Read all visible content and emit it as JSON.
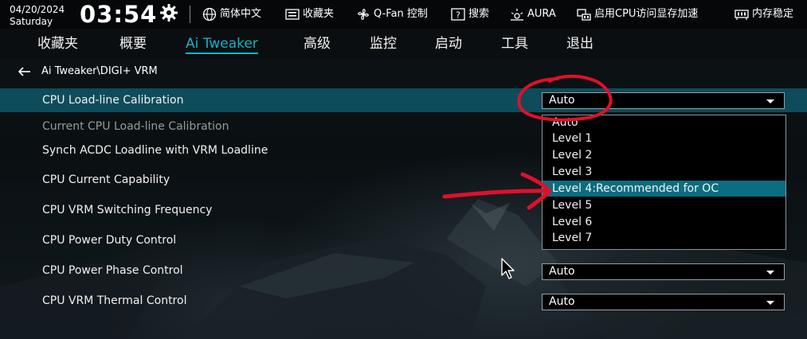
{
  "status": {
    "date": "04/20/2024",
    "day": "Saturday",
    "time": "03:54"
  },
  "toolbar": [
    {
      "label": "简体中文",
      "icon": "globe-icon"
    },
    {
      "label": "收藏夹",
      "icon": "keyboard-icon"
    },
    {
      "label": "Q-Fan 控制",
      "icon": "fan-icon"
    },
    {
      "label": "搜索",
      "icon": "help-icon"
    },
    {
      "label": "AURA",
      "icon": "aura-icon"
    },
    {
      "label": "启用CPU访问显存加速",
      "icon": "memory-access-icon"
    },
    {
      "label": "内存稳定",
      "icon": "memory-icon"
    }
  ],
  "nav": {
    "tabs": [
      {
        "label": "收藏夹"
      },
      {
        "label": "概要"
      },
      {
        "label": "Ai Tweaker",
        "active": true
      },
      {
        "label": "高级"
      },
      {
        "label": "监控"
      },
      {
        "label": "启动"
      },
      {
        "label": "工具"
      },
      {
        "label": "退出"
      }
    ]
  },
  "breadcrumb": "Ai Tweaker\\DIGI+ VRM",
  "settings": [
    {
      "label": "CPU Load-line Calibration",
      "value": "Auto",
      "selected": true
    },
    {
      "label": "Current CPU Load-line Calibration",
      "dim": true
    },
    {
      "label": "Synch ACDC Loadline with VRM Loadline"
    },
    {
      "label": "CPU Current Capability"
    },
    {
      "label": "CPU VRM Switching Frequency"
    },
    {
      "label": "CPU Power Duty Control"
    },
    {
      "label": "CPU Power Phase Control",
      "value": "Auto"
    },
    {
      "label": "CPU VRM Thermal Control",
      "value": "Auto"
    }
  ],
  "dropdown": {
    "options": [
      "Auto",
      "Level 1",
      "Level 2",
      "Level 3",
      "Level 4:Recommended for OC",
      "Level 5",
      "Level 6",
      "Level 7"
    ],
    "highlighted": "Level 4:Recommended for OC"
  },
  "colors": {
    "accent": "#14b3c7",
    "selected_row": "#0e4c5b",
    "highlight_option": "#0b6d80",
    "annotation": "#e0102a"
  }
}
